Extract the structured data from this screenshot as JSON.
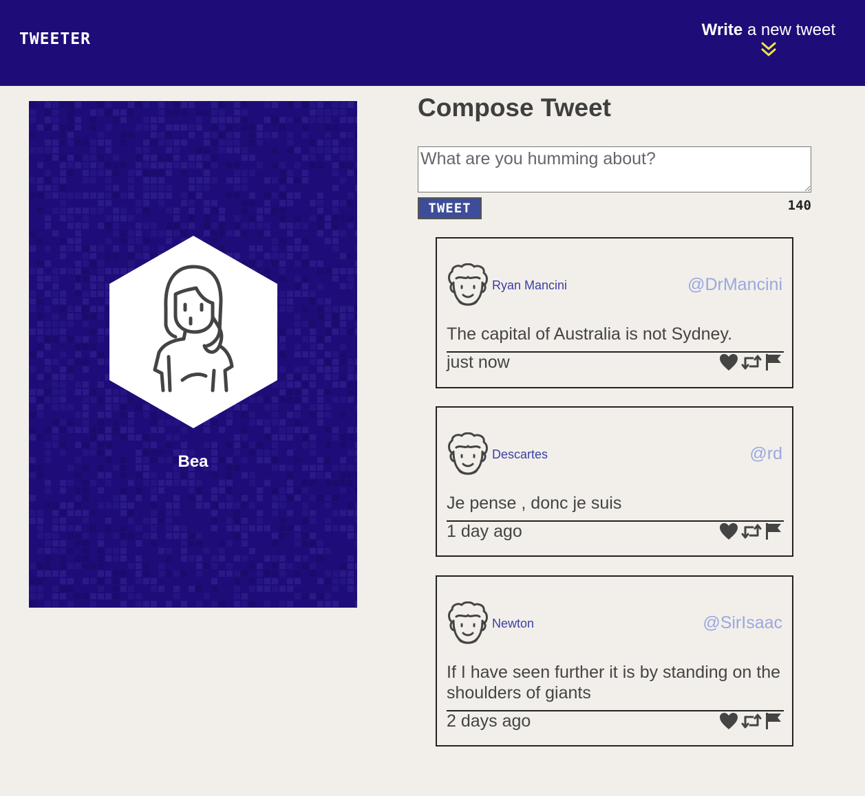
{
  "app": {
    "brand": "TWEETER"
  },
  "nav": {
    "compose_bold": "Write",
    "compose_rest": " a new tweet",
    "compose_icon": "double-chevron-down-icon",
    "accent_color": "#f0e44a"
  },
  "colors": {
    "navbar": "#1e0d78",
    "background": "#f2efea",
    "username": "#3a3fa0",
    "handle": "#9aa8e0",
    "button": "#3e4d9a"
  },
  "profile": {
    "name": "Bea",
    "avatar_icon": "woman-avatar-icon"
  },
  "composer": {
    "title": "Compose Tweet",
    "placeholder": "What are you humming about?",
    "button_label": "TWEET",
    "counter": "140"
  },
  "tweets": [
    {
      "name": "Ryan Mancini",
      "handle": "@DrMancini",
      "content": "The capital of Australia is not Sydney.",
      "time": "just now",
      "avatar_icon": "curly-hair-man-avatar-icon"
    },
    {
      "name": "Descartes",
      "handle": "@rd",
      "content": "Je pense , donc je suis",
      "time": "1 day ago",
      "avatar_icon": "curly-hair-man-avatar-icon"
    },
    {
      "name": "Newton",
      "handle": "@SirIsaac",
      "content": "If I have seen further it is by standing on the shoulders of giants",
      "time": "2 days ago",
      "avatar_icon": "curly-hair-man-avatar-icon"
    }
  ],
  "action_icons": [
    "heart-icon",
    "retweet-icon",
    "flag-icon"
  ]
}
